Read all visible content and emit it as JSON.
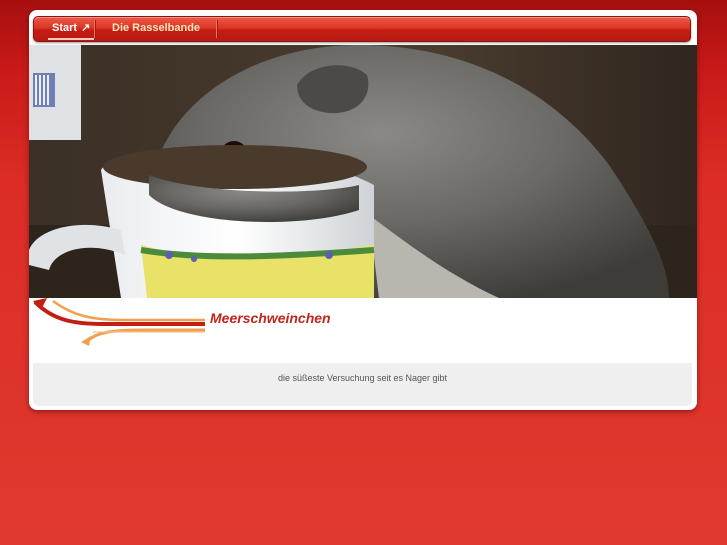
{
  "nav": {
    "items": [
      {
        "label": "Start",
        "active": true,
        "icon": "arrow-up-right-icon"
      },
      {
        "label": "Die Rasselbande",
        "active": false
      }
    ]
  },
  "hero": {
    "image": "guinea-pig-drinking-from-mug"
  },
  "header": {
    "title": "Meerschweinchen"
  },
  "footer": {
    "tagline": "die süßeste Versuchung seit es Nager gibt"
  },
  "colors": {
    "background": "#dc2c25",
    "nav": "#db3526",
    "title": "#c0261b",
    "footer_box": "#efefef"
  }
}
